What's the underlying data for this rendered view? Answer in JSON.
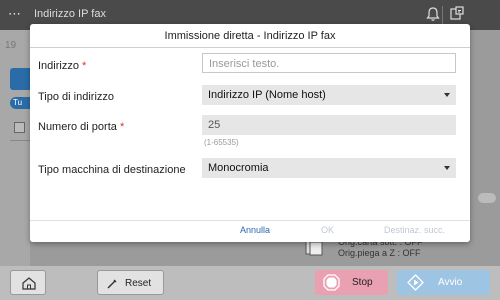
{
  "topbar": {
    "title": "Indirizzo IP fax",
    "menu_icon": "menu-icon",
    "bell_icon": "bell-icon",
    "device_icon": "device-status-icon"
  },
  "background": {
    "number_fragment": "19",
    "tab_fragment": "Tu",
    "info_line1": "Orig.carta sott. : OFF",
    "info_line2": "Orig.piega a Z : OFF"
  },
  "dialog": {
    "title": "Immissione diretta - Indirizzo IP fax",
    "address": {
      "label": "Indirizzo",
      "required_mark": "*",
      "placeholder": "Inserisci testo."
    },
    "address_type": {
      "label": "Tipo di indirizzo",
      "value": "Indirizzo IP (Nome host)"
    },
    "port": {
      "label": "Numero di porta",
      "required_mark": "*",
      "value": "25",
      "hint": "(1-65535)"
    },
    "machine_type": {
      "label": "Tipo macchina di destinazione",
      "value": "Monocromia"
    },
    "footer": {
      "cancel": "Annulla",
      "ok": "OK",
      "next": "Destinaz. succ."
    }
  },
  "bottombar": {
    "home_icon": "home-icon",
    "reset_label": "Reset",
    "stop_label": "Stop",
    "start_label": "Avvio"
  },
  "colors": {
    "accent": "#2a6ca8",
    "stop_button": "#e9a0b0",
    "start_button": "#9ec4e4",
    "required": "#e03030"
  }
}
